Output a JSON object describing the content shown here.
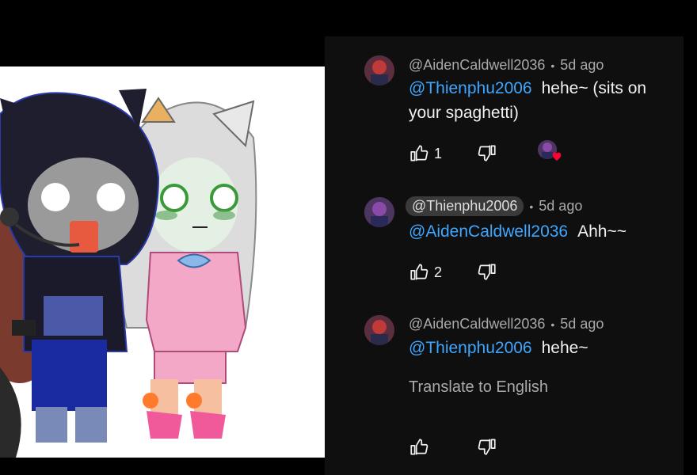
{
  "comments": [
    {
      "author": "@AidenCaldwell2036",
      "time": "5d ago",
      "mention": "@Thienphu2006",
      "text": "hehe~ (sits on your spaghetti)",
      "likes": "1",
      "hearted": true
    },
    {
      "author": "@Thienphu2006",
      "time": "5d ago",
      "mention": "@AidenCaldwell2036",
      "text": "Ahh~~",
      "likes": "2",
      "hearted": false
    },
    {
      "author": "@AidenCaldwell2036",
      "time": "5d ago",
      "mention": "@Thienphu2006",
      "text": "hehe~",
      "translate": "Translate to English",
      "likes": "",
      "hearted": false
    }
  ],
  "icons": {
    "like": "thumbs-up-icon",
    "dislike": "thumbs-down-icon",
    "heart": "heart-icon"
  },
  "colors": {
    "panel_bg": "#0f0f0f",
    "mention": "#3ea6ff",
    "meta": "#aaaaaa",
    "heart": "#ff0033"
  }
}
